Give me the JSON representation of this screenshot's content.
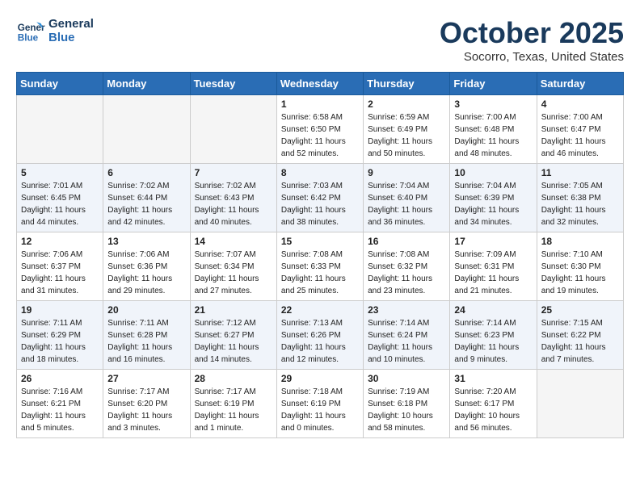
{
  "header": {
    "logo_line1": "General",
    "logo_line2": "Blue",
    "month": "October 2025",
    "location": "Socorro, Texas, United States"
  },
  "days_of_week": [
    "Sunday",
    "Monday",
    "Tuesday",
    "Wednesday",
    "Thursday",
    "Friday",
    "Saturday"
  ],
  "weeks": [
    [
      {
        "num": "",
        "info": "",
        "empty": true
      },
      {
        "num": "",
        "info": "",
        "empty": true
      },
      {
        "num": "",
        "info": "",
        "empty": true
      },
      {
        "num": "1",
        "info": "Sunrise: 6:58 AM\nSunset: 6:50 PM\nDaylight: 11 hours\nand 52 minutes."
      },
      {
        "num": "2",
        "info": "Sunrise: 6:59 AM\nSunset: 6:49 PM\nDaylight: 11 hours\nand 50 minutes."
      },
      {
        "num": "3",
        "info": "Sunrise: 7:00 AM\nSunset: 6:48 PM\nDaylight: 11 hours\nand 48 minutes."
      },
      {
        "num": "4",
        "info": "Sunrise: 7:00 AM\nSunset: 6:47 PM\nDaylight: 11 hours\nand 46 minutes."
      }
    ],
    [
      {
        "num": "5",
        "info": "Sunrise: 7:01 AM\nSunset: 6:45 PM\nDaylight: 11 hours\nand 44 minutes."
      },
      {
        "num": "6",
        "info": "Sunrise: 7:02 AM\nSunset: 6:44 PM\nDaylight: 11 hours\nand 42 minutes."
      },
      {
        "num": "7",
        "info": "Sunrise: 7:02 AM\nSunset: 6:43 PM\nDaylight: 11 hours\nand 40 minutes."
      },
      {
        "num": "8",
        "info": "Sunrise: 7:03 AM\nSunset: 6:42 PM\nDaylight: 11 hours\nand 38 minutes."
      },
      {
        "num": "9",
        "info": "Sunrise: 7:04 AM\nSunset: 6:40 PM\nDaylight: 11 hours\nand 36 minutes."
      },
      {
        "num": "10",
        "info": "Sunrise: 7:04 AM\nSunset: 6:39 PM\nDaylight: 11 hours\nand 34 minutes."
      },
      {
        "num": "11",
        "info": "Sunrise: 7:05 AM\nSunset: 6:38 PM\nDaylight: 11 hours\nand 32 minutes."
      }
    ],
    [
      {
        "num": "12",
        "info": "Sunrise: 7:06 AM\nSunset: 6:37 PM\nDaylight: 11 hours\nand 31 minutes."
      },
      {
        "num": "13",
        "info": "Sunrise: 7:06 AM\nSunset: 6:36 PM\nDaylight: 11 hours\nand 29 minutes."
      },
      {
        "num": "14",
        "info": "Sunrise: 7:07 AM\nSunset: 6:34 PM\nDaylight: 11 hours\nand 27 minutes."
      },
      {
        "num": "15",
        "info": "Sunrise: 7:08 AM\nSunset: 6:33 PM\nDaylight: 11 hours\nand 25 minutes."
      },
      {
        "num": "16",
        "info": "Sunrise: 7:08 AM\nSunset: 6:32 PM\nDaylight: 11 hours\nand 23 minutes."
      },
      {
        "num": "17",
        "info": "Sunrise: 7:09 AM\nSunset: 6:31 PM\nDaylight: 11 hours\nand 21 minutes."
      },
      {
        "num": "18",
        "info": "Sunrise: 7:10 AM\nSunset: 6:30 PM\nDaylight: 11 hours\nand 19 minutes."
      }
    ],
    [
      {
        "num": "19",
        "info": "Sunrise: 7:11 AM\nSunset: 6:29 PM\nDaylight: 11 hours\nand 18 minutes."
      },
      {
        "num": "20",
        "info": "Sunrise: 7:11 AM\nSunset: 6:28 PM\nDaylight: 11 hours\nand 16 minutes."
      },
      {
        "num": "21",
        "info": "Sunrise: 7:12 AM\nSunset: 6:27 PM\nDaylight: 11 hours\nand 14 minutes."
      },
      {
        "num": "22",
        "info": "Sunrise: 7:13 AM\nSunset: 6:26 PM\nDaylight: 11 hours\nand 12 minutes."
      },
      {
        "num": "23",
        "info": "Sunrise: 7:14 AM\nSunset: 6:24 PM\nDaylight: 11 hours\nand 10 minutes."
      },
      {
        "num": "24",
        "info": "Sunrise: 7:14 AM\nSunset: 6:23 PM\nDaylight: 11 hours\nand 9 minutes."
      },
      {
        "num": "25",
        "info": "Sunrise: 7:15 AM\nSunset: 6:22 PM\nDaylight: 11 hours\nand 7 minutes."
      }
    ],
    [
      {
        "num": "26",
        "info": "Sunrise: 7:16 AM\nSunset: 6:21 PM\nDaylight: 11 hours\nand 5 minutes."
      },
      {
        "num": "27",
        "info": "Sunrise: 7:17 AM\nSunset: 6:20 PM\nDaylight: 11 hours\nand 3 minutes."
      },
      {
        "num": "28",
        "info": "Sunrise: 7:17 AM\nSunset: 6:19 PM\nDaylight: 11 hours\nand 1 minute."
      },
      {
        "num": "29",
        "info": "Sunrise: 7:18 AM\nSunset: 6:19 PM\nDaylight: 11 hours\nand 0 minutes."
      },
      {
        "num": "30",
        "info": "Sunrise: 7:19 AM\nSunset: 6:18 PM\nDaylight: 10 hours\nand 58 minutes."
      },
      {
        "num": "31",
        "info": "Sunrise: 7:20 AM\nSunset: 6:17 PM\nDaylight: 10 hours\nand 56 minutes."
      },
      {
        "num": "",
        "info": "",
        "empty": true
      }
    ]
  ]
}
